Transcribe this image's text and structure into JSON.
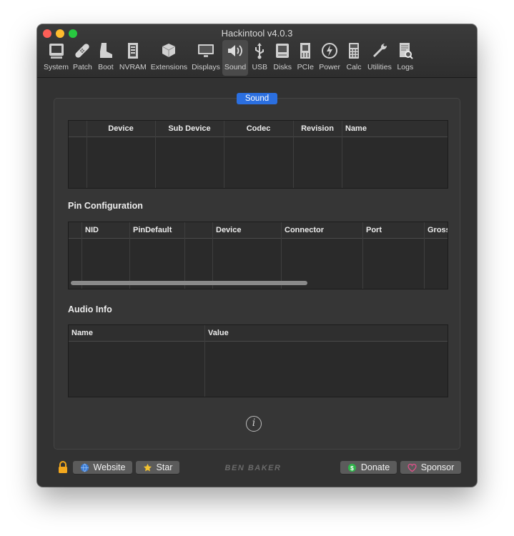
{
  "window": {
    "title": "Hackintool v4.0.3"
  },
  "toolbar": {
    "items": [
      {
        "label": "System",
        "icon": "system-icon"
      },
      {
        "label": "Patch",
        "icon": "patch-icon"
      },
      {
        "label": "Boot",
        "icon": "boot-icon"
      },
      {
        "label": "NVRAM",
        "icon": "nvram-icon"
      },
      {
        "label": "Extensions",
        "icon": "extensions-icon"
      },
      {
        "label": "Displays",
        "icon": "displays-icon"
      },
      {
        "label": "Sound",
        "icon": "sound-icon",
        "active": true
      },
      {
        "label": "USB",
        "icon": "usb-icon"
      },
      {
        "label": "Disks",
        "icon": "disks-icon"
      },
      {
        "label": "PCIe",
        "icon": "pcie-icon"
      },
      {
        "label": "Power",
        "icon": "power-icon"
      },
      {
        "label": "Calc",
        "icon": "calc-icon"
      },
      {
        "label": "Utilities",
        "icon": "utilities-icon"
      },
      {
        "label": "Logs",
        "icon": "logs-icon"
      }
    ]
  },
  "tab": {
    "label": "Sound"
  },
  "devices_table": {
    "columns": [
      "",
      "Device",
      "Sub Device",
      "Codec",
      "Revision",
      "Name"
    ],
    "rows": []
  },
  "pin_config": {
    "title": "Pin Configuration",
    "columns": [
      "",
      "NID",
      "PinDefault",
      "",
      "Device",
      "Connector",
      "Port",
      "Gross"
    ],
    "rows": []
  },
  "audio_info": {
    "title": "Audio Info",
    "columns": [
      "Name",
      "Value"
    ],
    "rows": []
  },
  "footer": {
    "website_label": "Website",
    "star_label": "Star",
    "brand": "BEN BAKER",
    "donate_label": "Donate",
    "sponsor_label": "Sponsor"
  },
  "colors": {
    "accent": "#2b6fe0",
    "window_bg": "#323232"
  }
}
